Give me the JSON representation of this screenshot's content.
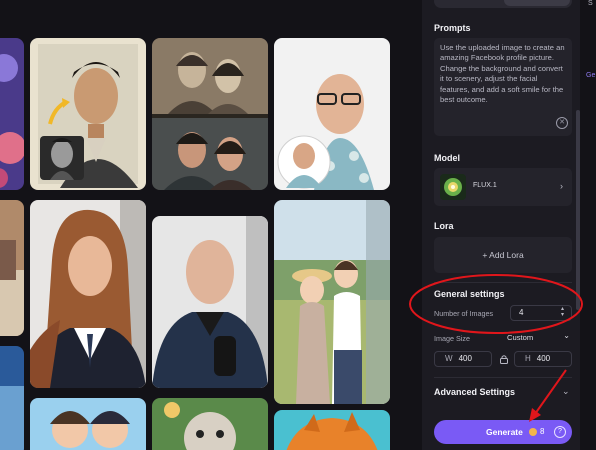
{
  "panel": {
    "prompts_title": "Prompts",
    "prompt_text": "Use the uploaded image to create an amazing Facebook profile picture. Change the background and convert it to scenery, adjust the facial features, and add a soft smile for the best outcome.",
    "model_title": "Model",
    "model_name": "FLUX.1",
    "lora_title": "Lora",
    "add_lora_label": "+ Add Lora",
    "general_settings_title": "General settings",
    "number_of_images_label": "Number of Images",
    "number_of_images_value": "4",
    "image_size_label": "Image Size",
    "image_size_value": "Custom",
    "width_label": "W",
    "width_value": "400",
    "height_label": "H",
    "height_value": "400",
    "advanced_settings_title": "Advanced Settings",
    "generate_label": "Generate",
    "generate_cost": "8"
  },
  "edge": {
    "top_right_text": "S",
    "mid_right_text": "Ge"
  },
  "colors": {
    "accent": "#7a5af5",
    "annotation_red": "#e0161b",
    "panel_bg": "#1c1b22"
  },
  "icons": [
    "clear-icon",
    "chevron-right-icon",
    "chevron-down-icon",
    "stepper-icon",
    "lock-icon",
    "coin-icon",
    "help-icon"
  ]
}
